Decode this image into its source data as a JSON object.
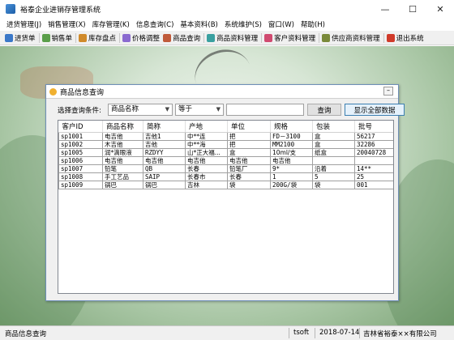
{
  "window": {
    "title": "裕泰企业进销存管理系统",
    "min": "—",
    "max": "☐",
    "close": "✕"
  },
  "menu": [
    "进货管理(J)",
    "销售管理(X)",
    "库存管理(K)",
    "信息查询(C)",
    "基本资料(B)",
    "系统维护(S)",
    "窗口(W)",
    "帮助(H)"
  ],
  "toolbar": [
    {
      "label": "进货单",
      "icon": "document-icon",
      "color": "#3b78c8"
    },
    {
      "label": "销售单",
      "icon": "sheet-icon",
      "color": "#5a9e4a"
    },
    {
      "label": "库存盘点",
      "icon": "box-icon",
      "color": "#d08a2a"
    },
    {
      "label": "价格调整",
      "icon": "price-icon",
      "color": "#8a6ad0"
    },
    {
      "label": "商品查询",
      "icon": "person-search-icon",
      "color": "#c05a3a"
    },
    {
      "label": "商品资料管理",
      "icon": "goods-icon",
      "color": "#3aa0a0"
    },
    {
      "label": "客户资料管理",
      "icon": "customer-icon",
      "color": "#d04a70"
    },
    {
      "label": "供应商资料管理",
      "icon": "supplier-icon",
      "color": "#7a8a3a"
    },
    {
      "label": "退出系统",
      "icon": "exit-icon",
      "color": "#d03a2a"
    }
  ],
  "dialog": {
    "title": "商品信息查询",
    "search_label": "选择查询条件:",
    "field_select": "商品名称",
    "op_select": "等于",
    "query_button": "查询",
    "show_all_button": "显示全部数据"
  },
  "table": {
    "columns": [
      "客户ID",
      "商品名称",
      "简称",
      "产地",
      "单位",
      "规格",
      "包装",
      "批号"
    ],
    "rows": [
      [
        "sp1001",
        "电吉他",
        "吉他1",
        "中**连",
        "把",
        "FD－3100",
        "盒",
        "56217"
      ],
      [
        "sp1002",
        "木吉他",
        "吉他",
        "中**海",
        "把",
        "MM2100",
        "盒",
        "32286"
      ],
      [
        "sp1005",
        "润*滴眼液",
        "RZDYY",
        "山*正大福...",
        "盒",
        "10ml/支",
        "纸盒",
        "20040728"
      ],
      [
        "sp1006",
        "电吉他",
        "电吉他",
        "电吉他",
        "电吉他",
        "电吉他",
        "",
        ""
      ],
      [
        "sp1007",
        "铅笔",
        "QB",
        "长春",
        "铅笔厂",
        "9*",
        "沿着",
        "14**"
      ],
      [
        "sp1008",
        "手工艺品",
        "SAIP",
        "长春市",
        "长春",
        "1",
        "5",
        "25"
      ],
      [
        "sp1009",
        "锅巴",
        "锅巴",
        "吉林",
        "袋",
        "200G/袋",
        "袋",
        "001"
      ]
    ]
  },
  "status": {
    "left": "商品信息查询",
    "user": "tsoft",
    "date": "2018-07-14",
    "company": "吉林省裕泰××有限公司"
  }
}
